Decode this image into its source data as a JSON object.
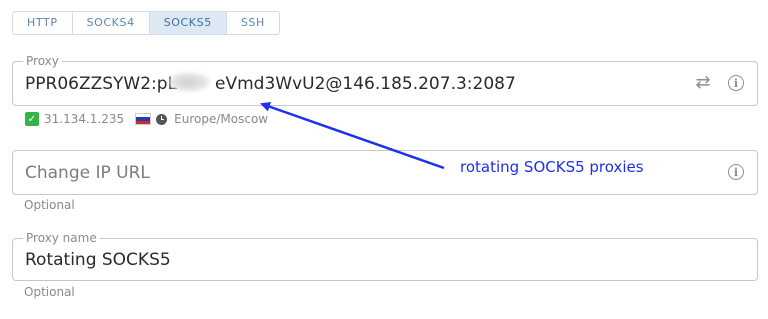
{
  "tabs": [
    {
      "label": "HTTP",
      "active": false
    },
    {
      "label": "SOCKS4",
      "active": false
    },
    {
      "label": "SOCKS5",
      "active": true
    },
    {
      "label": "SSH",
      "active": false
    }
  ],
  "proxy": {
    "legend": "Proxy",
    "value_before_blur": "PPR06ZZSYW2:pL",
    "value_after_blur": "eVmd3WvU2@146.185.207.3:2087",
    "swap_icon": "swap-icon",
    "info_icon": "info-icon"
  },
  "status": {
    "ip": "31.134.1.235",
    "timezone": "Europe/Moscow",
    "check_color": "#35b34a",
    "flag_colors": [
      "#ffffff",
      "#1c3fb8",
      "#d52b1e"
    ]
  },
  "change_ip": {
    "placeholder": "Change IP URL",
    "helper": "Optional",
    "info_icon": "info-icon"
  },
  "proxy_name": {
    "legend": "Proxy name",
    "value": "Rotating SOCKS5",
    "helper": "Optional"
  },
  "annotation": {
    "text": "rotating SOCKS5 proxies",
    "color": "#1d2ff0"
  }
}
